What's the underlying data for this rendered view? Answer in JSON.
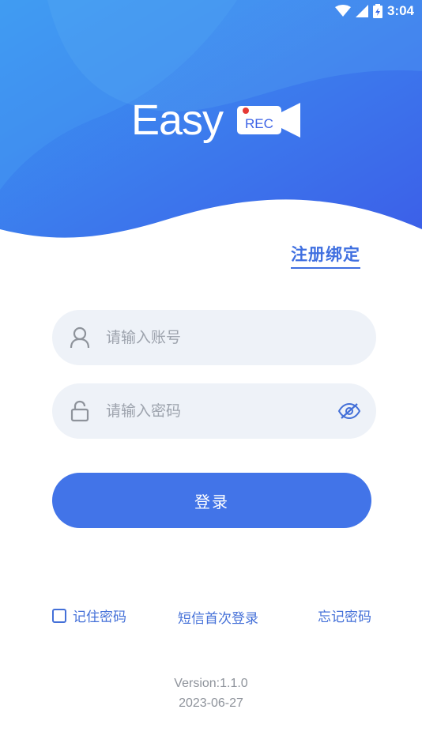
{
  "status_bar": {
    "time": "3:04"
  },
  "logo": {
    "text": "Easy",
    "badge": "REC"
  },
  "register": {
    "label": "注册绑定"
  },
  "account": {
    "placeholder": "请输入账号",
    "value": ""
  },
  "password": {
    "placeholder": "请输入密码",
    "value": ""
  },
  "login": {
    "label": "登录"
  },
  "options": {
    "remember_label": "记住密码",
    "remember_checked": false,
    "sms_login_label": "短信首次登录",
    "forgot_label": "忘记密码"
  },
  "footer": {
    "version": "Version:1.1.0",
    "date": "2023-06-27"
  },
  "colors": {
    "primary": "#4274e8",
    "header_light": "#3d8ff0",
    "header_dark": "#3b5fe6"
  },
  "icons": [
    "wifi-icon",
    "signal-icon",
    "battery-icon",
    "user-icon",
    "lock-icon",
    "eye-off-icon"
  ]
}
